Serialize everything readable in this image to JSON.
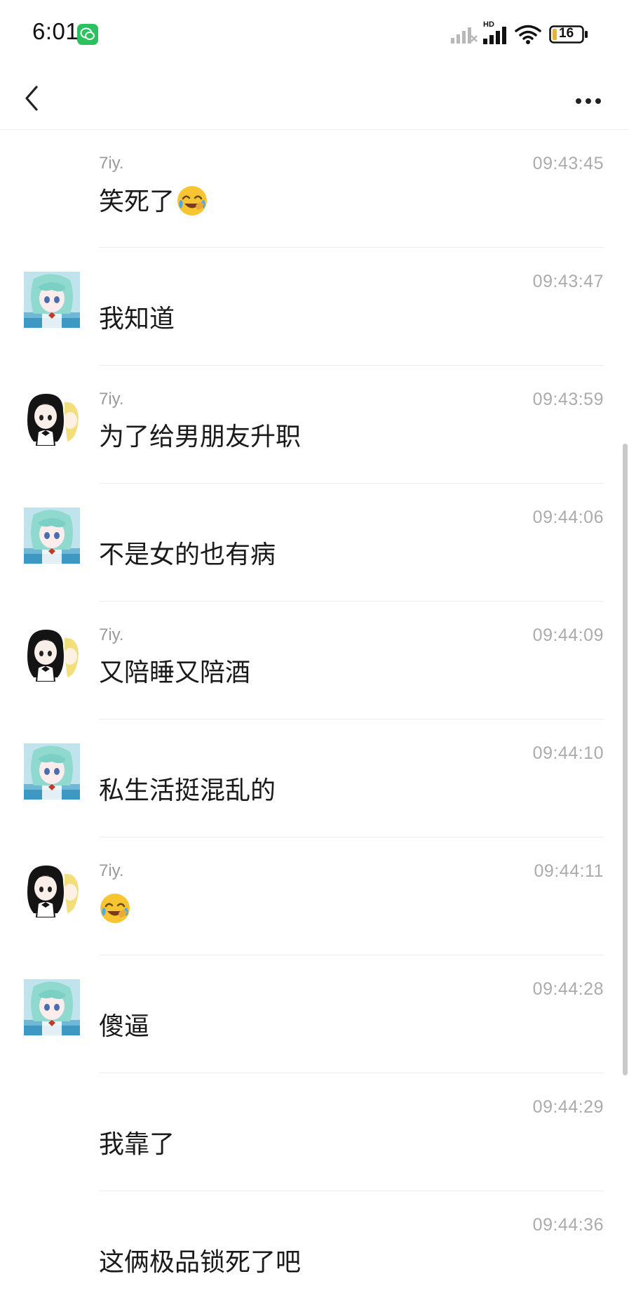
{
  "status_bar": {
    "time": "6:01",
    "battery": "16",
    "network_badge": "HD"
  },
  "header": {
    "back_icon": "chevron-left-icon",
    "more_icon": "more-horizontal-icon"
  },
  "messages": [
    {
      "sender": "7iy.",
      "time": "09:43:45",
      "text": "笑死了",
      "emoji": "face-with-tears-of-joy",
      "avatar": ""
    },
    {
      "sender": "",
      "time": "09:43:47",
      "text": "我知道",
      "emoji": "",
      "avatar": "teal-hair-anime-avatar"
    },
    {
      "sender": "7iy.",
      "time": "09:43:59",
      "text": "为了给男朋友升职",
      "emoji": "",
      "avatar": "black-hair-anime-avatar"
    },
    {
      "sender": "",
      "time": "09:44:06",
      "text": "不是女的也有病",
      "emoji": "",
      "avatar": "teal-hair-anime-avatar"
    },
    {
      "sender": "7iy.",
      "time": "09:44:09",
      "text": "又陪睡又陪酒",
      "emoji": "",
      "avatar": "black-hair-anime-avatar"
    },
    {
      "sender": "",
      "time": "09:44:10",
      "text": "私生活挺混乱的",
      "emoji": "",
      "avatar": "teal-hair-anime-avatar"
    },
    {
      "sender": "7iy.",
      "time": "09:44:11",
      "text": "",
      "emoji": "face-with-tears-of-joy",
      "avatar": "black-hair-anime-avatar"
    },
    {
      "sender": "",
      "time": "09:44:28",
      "text": "傻逼",
      "emoji": "",
      "avatar": "teal-hair-anime-avatar"
    },
    {
      "sender": "",
      "time": "09:44:29",
      "text": "我靠了",
      "emoji": "",
      "avatar": ""
    },
    {
      "sender": "",
      "time": "09:44:36",
      "text": "这俩极品锁死了吧",
      "emoji": "",
      "avatar": ""
    }
  ]
}
